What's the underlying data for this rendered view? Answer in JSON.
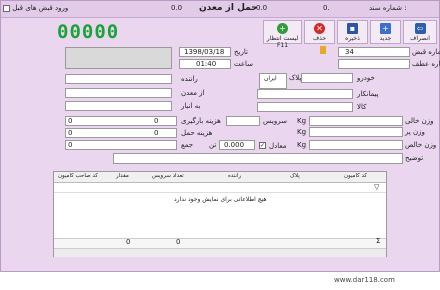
{
  "title": {
    "doc_label": "شماره سند :",
    "doc_value": "0.",
    "center_title": "حمل از معدن",
    "dots_left": "0.0",
    "dots_mid": "0.0",
    "prev_receipts_label": "ورود قبض های قبل"
  },
  "toolbar": {
    "cancel": "انصراف",
    "new": "جدید",
    "save": "ذخیره",
    "delete": "حذف",
    "wait_list": "لیست انتظار F11"
  },
  "counter": "00000",
  "form": {
    "receipt_no_label": "شماره قبض",
    "receipt_no": "34",
    "atf_no_label": "شماره عطف",
    "date_label": "تاریخ",
    "date": "1398/03/18",
    "time_label": "ساعت",
    "time": "01:40",
    "vehicle_label": "خودرو",
    "plate_label": "پلاک",
    "plate_value": "ایران",
    "driver_label": "راننده",
    "contractor_label": "پیمانکار",
    "from_mine_label": "از معدن",
    "goods_label": "کالا",
    "to_warehouse_label": "به انبار",
    "empty_weight_label": "وزن خالی",
    "full_weight_label": "وزن پر",
    "net_weight_label": "وزن خالص",
    "unit": "Kg",
    "service_label": "سرویس",
    "loading_cost_label": "هزینه بارگیری",
    "transport_cost_label": "هزینه حمل",
    "total_label": "جمع",
    "zero": "0",
    "net_rate": "0.000",
    "ton_label": "تن",
    "deductible_label": "معادل",
    "desc_label": "توضیح"
  },
  "grid": {
    "columns": [
      "کد کامیون",
      "پلاک",
      "راننده",
      "تعداد سرویس",
      "مقدار",
      "کد صاحب کامیون"
    ],
    "empty_message": "هیچ اطلاعاتی برای نمایش وجود ندارد",
    "footer_services": "0",
    "footer_amount": "0",
    "sigma": "Σ"
  },
  "watermark": "www.dar118.com"
}
